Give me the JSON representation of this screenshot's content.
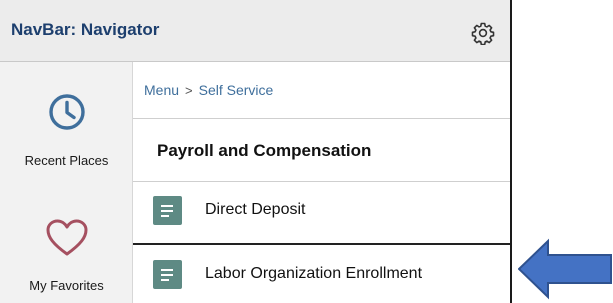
{
  "navbar": {
    "title": "NavBar: Navigator",
    "settings_icon": "gear-icon"
  },
  "sidebar": {
    "items": [
      {
        "label": "Recent Places",
        "icon": "clock-icon"
      },
      {
        "label": "My Favorites",
        "icon": "heart-icon"
      }
    ]
  },
  "breadcrumb": {
    "items": [
      "Menu",
      "Self Service"
    ],
    "separator": ">"
  },
  "section": {
    "title": "Payroll and Compensation"
  },
  "menu_items": [
    {
      "label": "Direct Deposit",
      "icon": "document-icon"
    },
    {
      "label": "Labor Organization Enrollment",
      "icon": "document-icon"
    }
  ],
  "callout": {
    "icon": "left-arrow-icon",
    "color": "#4472c4"
  },
  "colors": {
    "title": "#1d3f6e",
    "accent_blue": "#3f6f9c",
    "icon_green": "#5e8a84",
    "heart": "#a55060"
  }
}
